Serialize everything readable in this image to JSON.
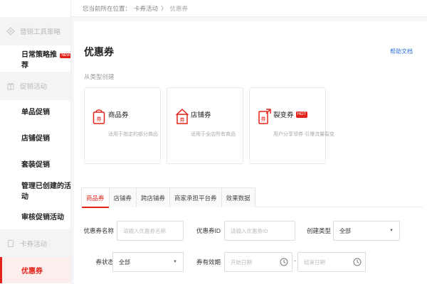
{
  "breadcrumb": {
    "prefix": "您当前所在位置：",
    "parent": "卡券活动",
    "sep": "〉",
    "current": "优惠券"
  },
  "sidebar": {
    "groups": [
      {
        "label": "营销工具策略"
      },
      {
        "label": "促销活动"
      },
      {
        "label": "卡券活动"
      }
    ],
    "items": [
      {
        "label": "日常策略推荐",
        "badge": "NEW"
      },
      {
        "label": "单品促销"
      },
      {
        "label": "店铺促销"
      },
      {
        "label": "套装促销"
      },
      {
        "label": "管理已创建的活动"
      },
      {
        "label": "审核促销活动"
      },
      {
        "label": "优惠券"
      }
    ]
  },
  "main": {
    "title": "优惠券",
    "help_link": "帮助文档",
    "section_label": "从类型创建",
    "cards": [
      {
        "title": "商品券",
        "desc": "适用于指定的部分商品",
        "icon_glyph": "券"
      },
      {
        "title": "店铺券",
        "desc": "适用于全店所有商品",
        "icon_glyph": "券"
      },
      {
        "title": "裂变券",
        "desc": "用户分享领券 引爆流量裂变",
        "badge": "HOT",
        "icon_glyph": "券"
      }
    ],
    "tabs": [
      {
        "label": "商品券"
      },
      {
        "label": "店铺券"
      },
      {
        "label": "跨店铺券"
      },
      {
        "label": "商家承担平台券"
      },
      {
        "label": "效果数据"
      }
    ],
    "form": {
      "name_label": "优惠券名称",
      "name_placeholder": "请输入优惠券名称",
      "id_label": "优惠券ID",
      "id_placeholder": "请输入优惠券ID",
      "create_type_label": "创建类型",
      "create_type_value": "全部",
      "status_label": "券状态",
      "status_value": "全部",
      "validity_label": "券有效期",
      "start_placeholder": "开始日期",
      "end_placeholder": "结束日期",
      "range_sep": "-"
    }
  },
  "colors": {
    "accent": "#e2231a",
    "link": "#2f6fd8"
  }
}
